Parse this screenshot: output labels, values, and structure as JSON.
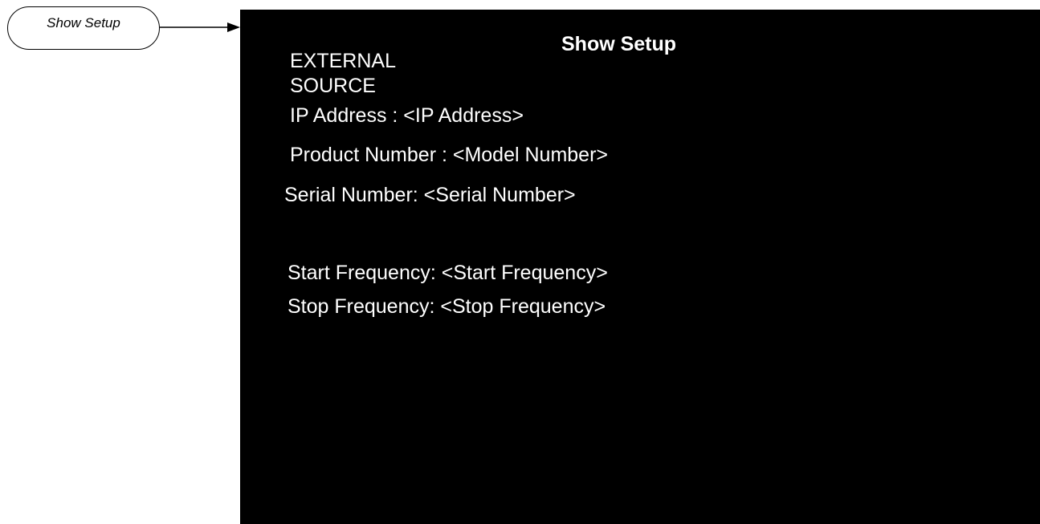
{
  "softkey": {
    "label": "Show Setup"
  },
  "screen": {
    "title": "Show Setup",
    "source": "EXTERNAL SOURCE",
    "ip_address": "IP Address : <IP Address>",
    "product_number": "Product Number : <Model Number>",
    "serial_number": "Serial Number: <Serial Number>",
    "start_frequency": "Start Frequency: <Start Frequency>",
    "stop_frequency": "Stop Frequency: <Stop Frequency>"
  },
  "colors": {
    "screen_background": "#000000",
    "screen_text": "#ffffff",
    "page_background": "#ffffff"
  },
  "icons": {
    "pointer": "arrow-right-icon"
  }
}
